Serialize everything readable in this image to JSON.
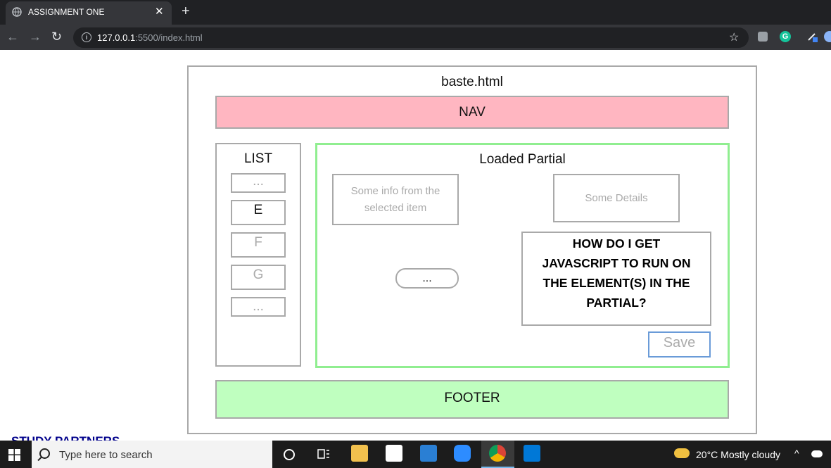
{
  "browser": {
    "tab_title": "ASSIGNMENT ONE",
    "tab_close": "✕",
    "new_tab": "+",
    "url_host": "127.0.0.1",
    "url_path": ":5500/index.html",
    "back": "←",
    "forward": "→",
    "reload": "↻",
    "star": "☆"
  },
  "page": {
    "title": "baste.html",
    "nav": "NAV",
    "list": {
      "heading": "LIST",
      "items": [
        "...",
        "E",
        "F",
        "G",
        "..."
      ]
    },
    "partial": {
      "heading": "Loaded Partial",
      "info_box": "Some info from the selected item",
      "details_box": "Some Details",
      "pill_button": "...",
      "question": "HOW DO I GET JAVASCRIPT TO RUN ON THE ELEMENT(S) IN THE PARTIAL?",
      "save": "Save"
    },
    "footer": "FOOTER",
    "below_fold_heading": "STUDY PARTNERS"
  },
  "taskbar": {
    "search_placeholder": "Type here to search",
    "weather": "20°C  Mostly cloudy",
    "chevron": "^",
    "apps": [
      "file-explorer",
      "store",
      "mail",
      "zoom",
      "chrome",
      "vscode"
    ]
  },
  "colors": {
    "nav_bg": "#ffb6c1",
    "footer_bg": "#bfffbf",
    "partial_border": "#90ee90",
    "save_border": "#6a9bd8"
  }
}
